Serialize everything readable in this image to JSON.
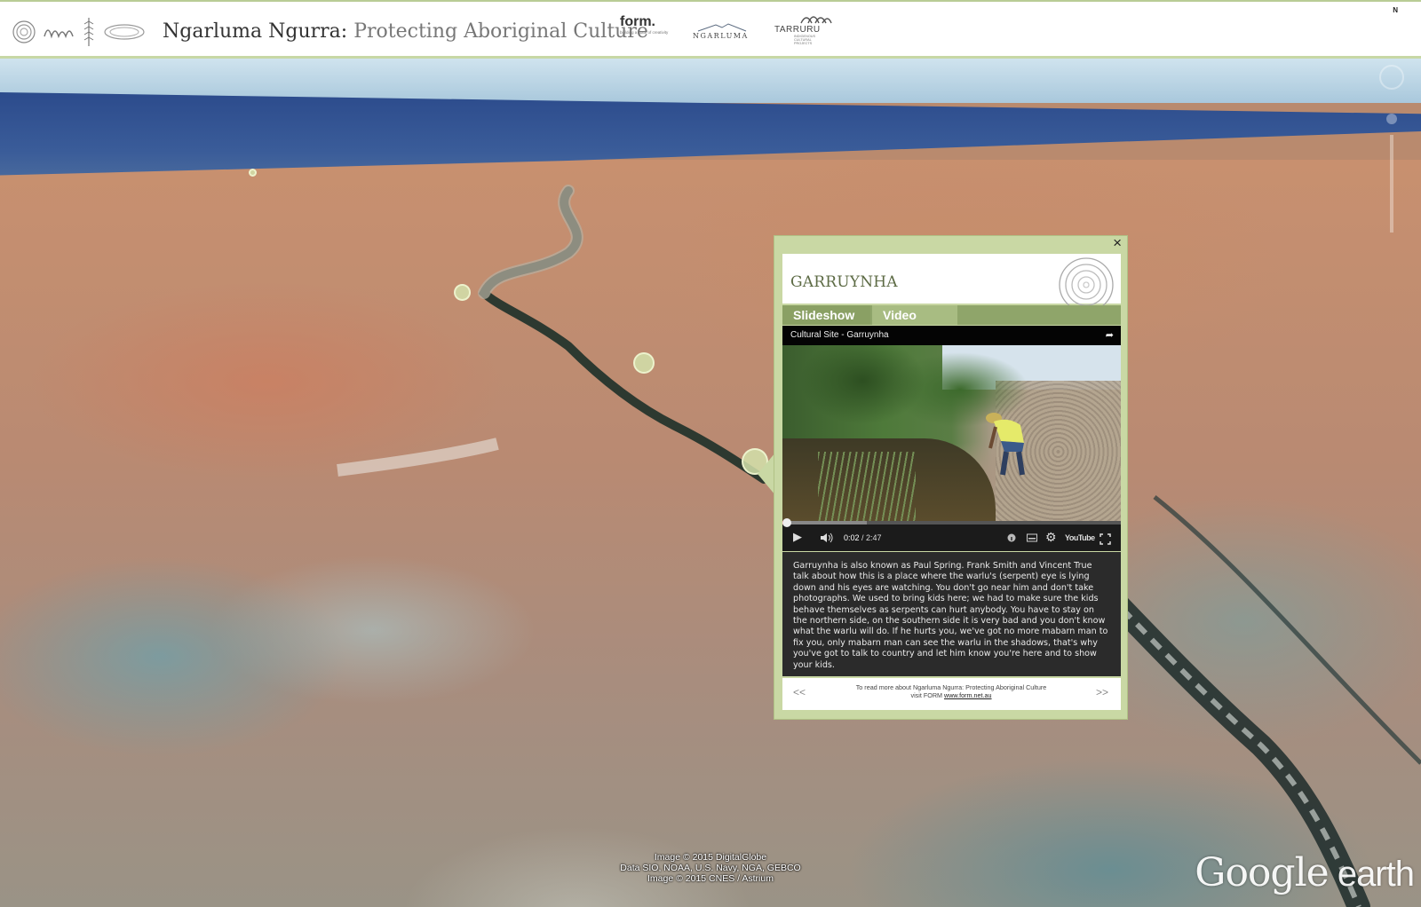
{
  "header": {
    "title_main": "Ngarluma Ngurra:",
    "title_sub": " Protecting Aboriginal Culture",
    "partners": {
      "form_name": "form.",
      "form_tagline": "building a state of creativity",
      "ngarluma": "NGARLUMA",
      "tarruru": "TARRURU",
      "tarruru_tagline": "INDIGENOUS CULTURAL PROJECTS"
    },
    "compass": "N"
  },
  "popup": {
    "close_label": "×",
    "title": "GARRUYNHA",
    "tabs": [
      {
        "label": "Slideshow"
      },
      {
        "label": "Video"
      }
    ],
    "video": {
      "title": "Cultural Site - Garruynha",
      "current_time": "0:02",
      "duration": "/ 2:47",
      "progress_fraction": 0.012,
      "loaded_fraction": 0.25,
      "youtube_label": "YouTube"
    },
    "description": "Garruynha is also known as Paul Spring. Frank Smith and Vincent True talk about how this is a place where the warlu's (serpent) eye is lying down and his eyes are watching. You don't go near him and don't take photographs. We used to bring kids here; we had to make sure the kids behave themselves as serpents can hurt anybody. You have to stay on the northern side, on the southern side it is very bad and you don't know what the warlu will do. If he hurts you, we've got no more mabarn man to fix you, only mabarn man can see the warlu in the shadows, that's why you've got to talk to country and let him know you're here and to show your kids.",
    "footer": {
      "prev": "<<",
      "next": ">>",
      "line1": "To read more about Ngarluma Ngurra: Protecting Aboriginal Culture",
      "line2_prefix": "visit FORM ",
      "link": "www.form.net.au"
    }
  },
  "attribution": {
    "line1": "Image © 2015 DigitalGlobe",
    "line2": "Data SIO, NOAA, U.S. Navy, NGA, GEBCO",
    "line3": "Image © 2015 CNES / Astrium"
  },
  "branding": {
    "google": "Google",
    "earth": " earth"
  },
  "colors": {
    "header_border": "#c7d8a5",
    "popup_bg": "#c9d8a4",
    "tab_active": "#8aa064",
    "title_green": "#5d6b45"
  }
}
